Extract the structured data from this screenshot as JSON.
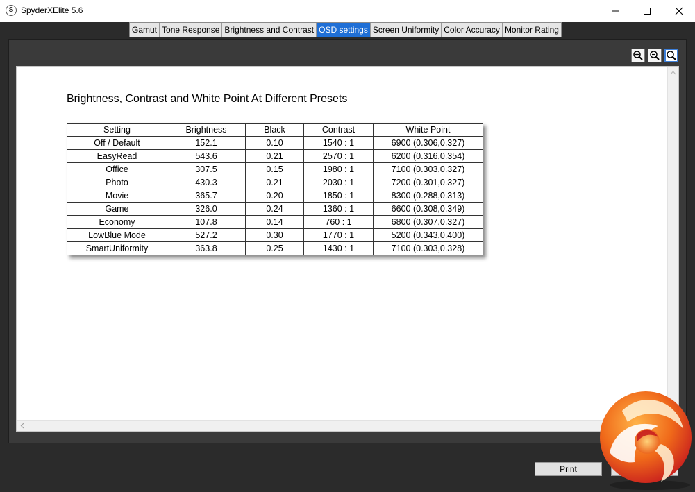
{
  "window": {
    "title": "SpyderXElite 5.6",
    "app_icon_letter": "S"
  },
  "tabs": [
    {
      "label": "Gamut",
      "active": false
    },
    {
      "label": "Tone Response",
      "active": false
    },
    {
      "label": "Brightness and Contrast",
      "active": false
    },
    {
      "label": "OSD settings",
      "active": true
    },
    {
      "label": "Screen Uniformity",
      "active": false
    },
    {
      "label": "Color Accuracy",
      "active": false
    },
    {
      "label": "Monitor Rating",
      "active": false
    }
  ],
  "zoom_icons": [
    "zoom-in-icon",
    "zoom-out-icon",
    "zoom-fit-icon"
  ],
  "report": {
    "title": "Brightness, Contrast and White Point At Different Presets",
    "columns": [
      "Setting",
      "Brightness",
      "Black",
      "Contrast",
      "White Point"
    ],
    "rows": [
      [
        "Off / Default",
        "152.1",
        "0.10",
        "1540 : 1",
        "6900 (0.306,0.327)"
      ],
      [
        "EasyRead",
        "543.6",
        "0.21",
        "2570 : 1",
        "6200 (0.316,0.354)"
      ],
      [
        "Office",
        "307.5",
        "0.15",
        "1980 : 1",
        "7100 (0.303,0.327)"
      ],
      [
        "Photo",
        "430.3",
        "0.21",
        "2030 : 1",
        "7200 (0.301,0.327)"
      ],
      [
        "Movie",
        "365.7",
        "0.20",
        "1850 : 1",
        "8300 (0.288,0.313)"
      ],
      [
        "Game",
        "326.0",
        "0.24",
        "1360 : 1",
        "6600 (0.308,0.349)"
      ],
      [
        "Economy",
        "107.8",
        "0.14",
        "760 : 1",
        "6800 (0.307,0.327)"
      ],
      [
        "LowBlue Mode",
        "527.2",
        "0.30",
        "1770 : 1",
        "5200 (0.343,0.400)"
      ],
      [
        "SmartUniformity",
        "363.8",
        "0.25",
        "1430 : 1",
        "7100 (0.303,0.328)"
      ]
    ]
  },
  "footer": {
    "print_label": "Print"
  },
  "colors": {
    "active_tab": "#1f6fd6",
    "panel_bg": "#2b2b2b",
    "logo_orange": "#f06a1a",
    "logo_red": "#c81e1e"
  }
}
